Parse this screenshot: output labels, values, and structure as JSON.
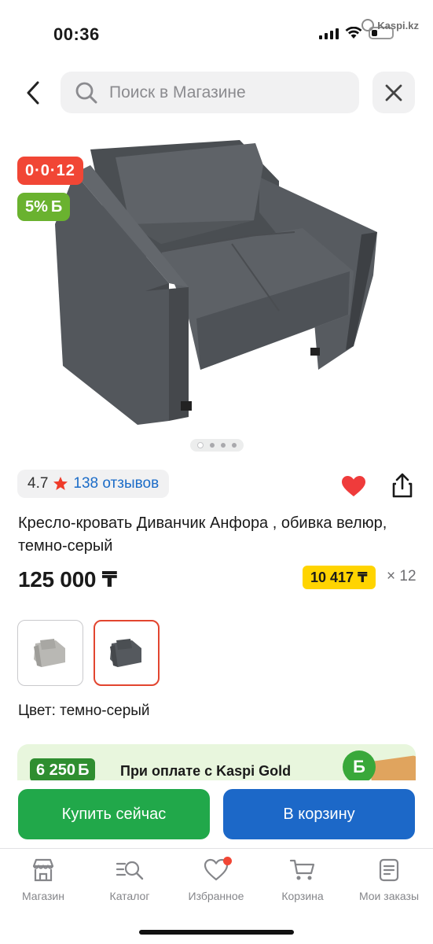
{
  "status_bar": {
    "time": "00:36",
    "watermark": "Kaspi.kz"
  },
  "search": {
    "placeholder": "Поиск в Магазине"
  },
  "icons": {
    "back": "chevron-left-icon",
    "search": "search-icon",
    "close": "close-icon",
    "favorite": "heart-icon",
    "share": "share-icon",
    "star": "star-icon"
  },
  "badges": {
    "installment": "0·0·12",
    "bonus_percent": "5%",
    "bonus_symbol": "Б"
  },
  "rating": {
    "score": "4.7",
    "reviews": "138 отзывов"
  },
  "product": {
    "title": "Кресло-кровать Диванчик Анфора , обивка велюр, темно-серый",
    "price": "125 000 ₸",
    "monthly_payment": "10 417 ₸",
    "multiplier": "× 12",
    "color_label": "Цвет: темно-серый",
    "carousel": {
      "count": 4,
      "active_index": 0
    }
  },
  "promo": {
    "amount": "6 250",
    "currency_symbol": "Б",
    "text": "При оплате с Kaspi Gold",
    "coin_symbol": "Б"
  },
  "actions": {
    "buy_now": "Купить сейчас",
    "add_to_cart": "В корзину"
  },
  "tabs": [
    {
      "label": "Магазин",
      "icon": "store-icon"
    },
    {
      "label": "Каталог",
      "icon": "catalog-search-icon"
    },
    {
      "label": "Избранное",
      "icon": "heart-outline-icon",
      "has_notification": true
    },
    {
      "label": "Корзина",
      "icon": "cart-icon"
    },
    {
      "label": "Мои заказы",
      "icon": "orders-icon"
    }
  ],
  "colors": {
    "red": "#f14635",
    "green": "#6ab22f",
    "yellow": "#ffd400",
    "buy_green": "#21a84a",
    "cart_blue": "#1c68c8",
    "link_blue": "#1b6cc8"
  }
}
